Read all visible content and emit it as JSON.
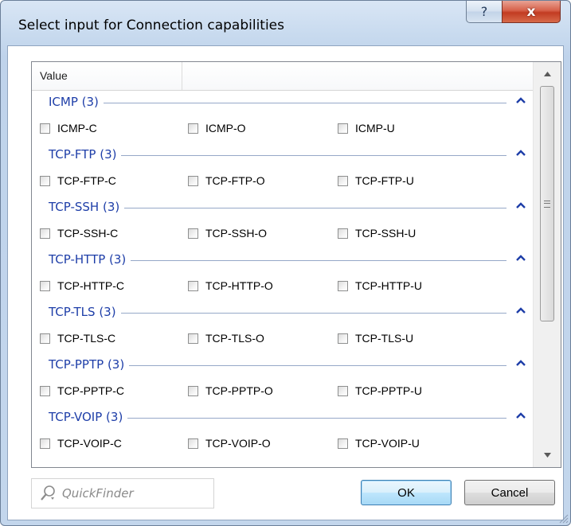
{
  "window": {
    "title": "Select input for Connection capabilities",
    "help_glyph": "?",
    "close_glyph": "x"
  },
  "table": {
    "column_header": "Value"
  },
  "groups": [
    {
      "title": "ICMP (3)",
      "items": [
        "ICMP-C",
        "ICMP-O",
        "ICMP-U"
      ]
    },
    {
      "title": "TCP-FTP (3)",
      "items": [
        "TCP-FTP-C",
        "TCP-FTP-O",
        "TCP-FTP-U"
      ]
    },
    {
      "title": "TCP-SSH (3)",
      "items": [
        "TCP-SSH-C",
        "TCP-SSH-O",
        "TCP-SSH-U"
      ]
    },
    {
      "title": "TCP-HTTP (3)",
      "items": [
        "TCP-HTTP-C",
        "TCP-HTTP-O",
        "TCP-HTTP-U"
      ]
    },
    {
      "title": "TCP-TLS (3)",
      "items": [
        "TCP-TLS-C",
        "TCP-TLS-O",
        "TCP-TLS-U"
      ]
    },
    {
      "title": "TCP-PPTP (3)",
      "items": [
        "TCP-PPTP-C",
        "TCP-PPTP-O",
        "TCP-PPTP-U"
      ]
    },
    {
      "title": "TCP-VOIP (3)",
      "items": [
        "TCP-VOIP-C",
        "TCP-VOIP-O",
        "TCP-VOIP-U"
      ]
    }
  ],
  "quickfinder": {
    "placeholder": "QuickFinder",
    "value": ""
  },
  "buttons": {
    "ok": "OK",
    "cancel": "Cancel"
  },
  "scroll": {
    "position_fraction": 0.0,
    "visible_fraction": 0.66
  },
  "colors": {
    "group_title": "#1e3ea8",
    "group_line": "#96a8c8",
    "window_frame": "#c9dbef",
    "close_button": "#c23b22"
  }
}
